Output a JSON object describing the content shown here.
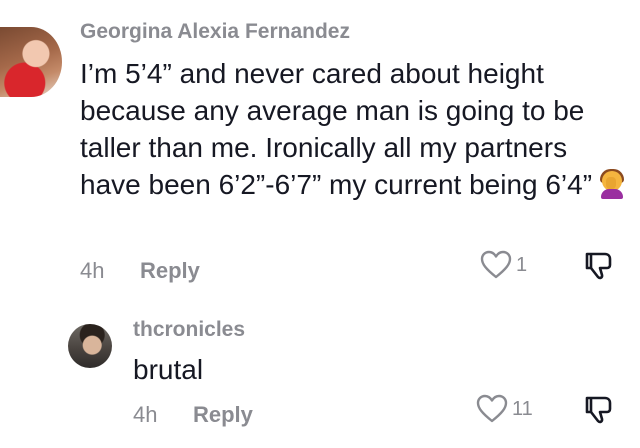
{
  "comments": [
    {
      "username": "Georgina Alexia Fernandez",
      "text": "I’m 5’4” and never cared about height because any average man is going to be taller than me. Ironically all my partners have been 6’2”-6’7” my current being 6’4”",
      "emoji": "face-palm-woman-emoji",
      "time": "4h",
      "reply_label": "Reply",
      "like_count": "1",
      "avatar": "avatar-georgina"
    },
    {
      "username": "thcronicles",
      "text": "brutal",
      "time": "4h",
      "reply_label": "Reply",
      "like_count": "11",
      "avatar": "avatar-thcronicles"
    }
  ],
  "icons": {
    "like": "heart-outline-icon",
    "dislike": "thumbs-down-icon"
  },
  "colors": {
    "text": "#161823",
    "muted": "#8a8b91",
    "background": "#ffffff"
  }
}
